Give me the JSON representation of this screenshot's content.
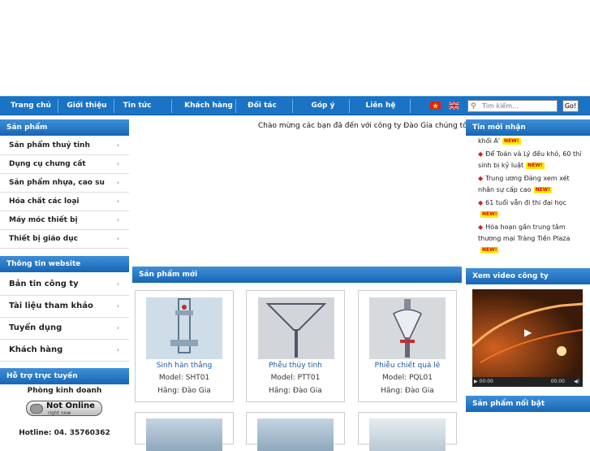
{
  "nav": {
    "items": [
      "Trang chủ",
      "Giới thiệu",
      "Tin tức",
      "Khách hàng",
      "Đối tác",
      "Góp ý",
      "Liên hệ"
    ],
    "search_placeholder": "Tìm kiếm...",
    "search_button": "Go!"
  },
  "sidebar": {
    "products_title": "Sản phẩm",
    "products": [
      "Sản phẩm thuỷ tinh",
      "Dụng cụ chưng cất",
      "Sản phẩm nhựa, cao su",
      "Hóa chất các loại",
      "Máy móc thiết bị",
      "Thiết bị giáo dục"
    ],
    "info_title": "Thông tin website",
    "info": [
      "Bản tin công ty",
      "Tài liệu tham khảo",
      "Tuyển dụng",
      "Khách hàng"
    ],
    "support_title": "Hỗ trợ trực tuyến",
    "support_dept": "Phòng kinh doanh",
    "status_main": "Not Online",
    "status_sub": "right now",
    "hotline": "Hotline: 04. 35760362"
  },
  "main": {
    "welcome": "Chào mừng các bạn đã đến với công ty Đào Gia chúng tôi!",
    "new_products_title": "Sản phẩm mới",
    "products": [
      {
        "name": "Sinh hàn thẳng",
        "model": "Model: SHT01",
        "brand": "Hãng: Đào Gia"
      },
      {
        "name": "Phễu thủy tinh",
        "model": "Model: PTT01",
        "brand": "Hãng: Đào Gia"
      },
      {
        "name": "Phiễu chiết quả lê",
        "model": "Model: PQL01",
        "brand": "Hãng: Đào Gia"
      }
    ]
  },
  "right": {
    "news_title": "Tin mới nhận",
    "news": [
      "khối A'",
      "Để Toán và Lý đều khó, 60 thí sinh bị kỷ luật",
      "Trung ương Đảng xem xét nhân sự cấp cao",
      "61 tuổi vẫn đi thi đại học",
      "Hỏa hoạn gần trung tâm thương mại Tràng Tiền Plaza"
    ],
    "new_label": "NEW!",
    "video_title": "Xem video công ty",
    "video_time_left": "00:00",
    "video_time_right": "00:00",
    "featured_title": "Sản phẩm nổi bật"
  },
  "colors": {
    "nav": "#1a73c4",
    "header": "#1766b4",
    "link": "#1a5aa8"
  }
}
